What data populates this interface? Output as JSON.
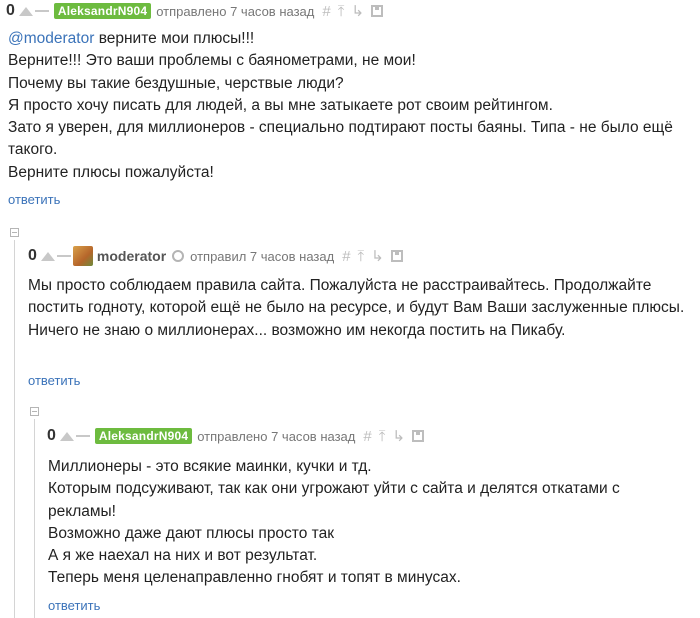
{
  "comments": [
    {
      "score": "0",
      "author": "AleksandrN904",
      "action": "отправлено 7 часов назад",
      "lines": [
        "@moderator",
        " верните мои плюсы!!!",
        "Верните!!! Это ваши проблемы с баянометрами, не мои!",
        "Почему вы такие бездушные, черствые люди?",
        "Я просто хочу писать для людей, а вы мне затыкаете рот своим рейтингом.",
        "Зато я уверен, для миллионеров - специально подтирают посты баяны. Типа - не было ещё такого.",
        "Верните плюсы пожалуйста!"
      ],
      "reply": "ответить"
    },
    {
      "score": "0",
      "author": "moderator",
      "action": "отправил 7 часов назад",
      "lines": [
        "Мы просто соблюдаем правила сайта. Пожалуйста не расстраивайтесь. Продолжайте постить годноту, которой ещё не было на ресурсе, и будут Вам Ваши заслуженные плюсы.",
        "Ничего не знаю о миллионерах... возможно им некогда постить на Пикабу."
      ],
      "reply": "ответить"
    },
    {
      "score": "0",
      "author": "AleksandrN904",
      "action": "отправлено 7 часов назад",
      "lines": [
        "Миллионеры - это всякие маинки, кучки и тд.",
        "Которым подсуживают, так как они угрожают уйти с сайта и делятся откатами с рекламы!",
        "Возможно даже дают плюсы просто так",
        "А я же наехал на них и вот результат.",
        "Теперь меня целенаправленно гнобят и топят в минусах."
      ],
      "reply": "ответить"
    }
  ],
  "icons": {
    "hash": "#",
    "up_arrow": "⤒",
    "branch": "↳"
  }
}
